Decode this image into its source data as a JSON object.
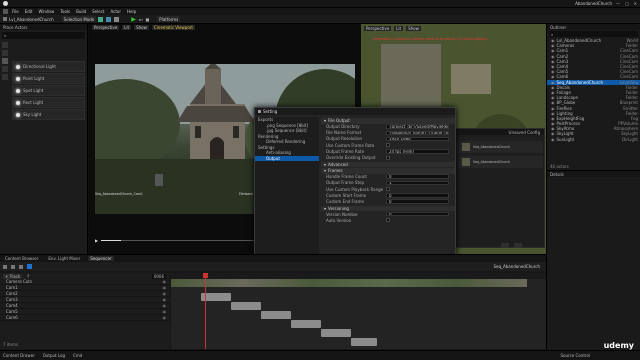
{
  "window": {
    "title": "AbandonedChurch"
  },
  "menu": [
    "File",
    "Edit",
    "Window",
    "Tools",
    "Build",
    "Select",
    "Actor",
    "Help"
  ],
  "toolbar": {
    "mode": "Selection Mode",
    "platforms": "Platforms"
  },
  "level_tab": "Lvl_AbandonedChurch",
  "place_actors": {
    "title": "Place Actors",
    "items": [
      "Directional Light",
      "Point Light",
      "Spot Light",
      "Rect Light",
      "Sky Light"
    ]
  },
  "viewport1": {
    "buttons": [
      "Perspective",
      "Lit",
      "Show",
      "Cinematic Viewport"
    ],
    "shot_label": "Seq_AbandonedChurch_Cam1",
    "info": "Filmback Preset: 16:9 DSLR | Zoom: 35 mm | Av: 2.8"
  },
  "viewport2": {
    "buttons": [
      "Perspective",
      "Lit",
      "Show"
    ],
    "warning": "Previewing in viewport. Lighting needs to be rebuilt (10 unbuilt objects)"
  },
  "dialog": {
    "title": "Setting",
    "nav": [
      {
        "label": "Exports",
        "indent": 0
      },
      {
        "label": ".png Sequence [8bit]",
        "indent": 1
      },
      {
        "label": ".jpg Sequence [8bit]",
        "indent": 1
      },
      {
        "label": "Rendering",
        "indent": 0
      },
      {
        "label": "Deferred Rendering",
        "indent": 1
      },
      {
        "label": "Settings",
        "indent": 0
      },
      {
        "label": "Anti-aliasing",
        "indent": 1
      },
      {
        "label": "Output",
        "indent": 1,
        "selected": true
      }
    ],
    "sections": [
      {
        "title": "File Output",
        "props": [
          {
            "label": "Output Directory",
            "value": "{project_dir}/Saved/MovieRenders/"
          },
          {
            "label": "File Name Format",
            "value": "{sequence_name}.{frame_number}"
          },
          {
            "label": "Output Resolution",
            "value": "1920     1080"
          },
          {
            "label": "Use Custom Frame Rate",
            "value": ""
          },
          {
            "label": "Output Frame Rate",
            "value": "24 fps (Film)"
          },
          {
            "label": "Override Existing Output",
            "value": ""
          }
        ]
      },
      {
        "title": "Advanced",
        "props": []
      },
      {
        "title": "Frames",
        "props": [
          {
            "label": "Handle Frame Count",
            "value": "0"
          },
          {
            "label": "Output Frame Step",
            "value": "1"
          },
          {
            "label": "Use Custom Playback Range",
            "value": ""
          },
          {
            "label": "Custom Start Frame",
            "value": "0"
          },
          {
            "label": "Custom End Frame",
            "value": "0"
          }
        ]
      },
      {
        "title": "Versioning",
        "props": [
          {
            "label": "Version Number",
            "value": "0"
          },
          {
            "label": "Auto Version",
            "value": ""
          }
        ]
      }
    ],
    "description": "A list of {format_strings} and example values that are valid to use in the File Name Format: {level_name} => L_AbandonedChurch {sequence_name} => Seq_AbandonedChurch {job_name} => Seq_AbandonedChurch {frame_rate} => 24",
    "cancel": "Cancel",
    "accept": "Accept"
  },
  "render_queue": {
    "title": "Unsaved Config",
    "jobs": [
      "Seq_AbandonedChurch",
      "Seq_AbandonedChurch"
    ]
  },
  "outliner": {
    "title": "Outliner",
    "items": [
      {
        "label": "Lvl_AbandonedChurch",
        "type": "World"
      },
      {
        "label": "Cameras",
        "type": "Folder"
      },
      {
        "label": "Cam1",
        "type": "CineCam"
      },
      {
        "label": "Cam2",
        "type": "CineCam"
      },
      {
        "label": "Cam3",
        "type": "CineCam"
      },
      {
        "label": "Cam4",
        "type": "CineCam"
      },
      {
        "label": "Cam5",
        "type": "CineCam"
      },
      {
        "label": "Cam6",
        "type": "CineCam"
      },
      {
        "label": "Seq_AbandonedChurch",
        "type": "LevelSeq"
      },
      {
        "label": "Decals",
        "type": "Folder"
      },
      {
        "label": "Foliage",
        "type": "Folder"
      },
      {
        "label": "Landscape",
        "type": "Folder"
      },
      {
        "label": "BP_Globe",
        "type": "Blueprint"
      },
      {
        "label": "Fireflies",
        "type": "Emitter"
      },
      {
        "label": "Lighting",
        "type": "Folder"
      },
      {
        "label": "ExpHeightFog",
        "type": "Fog"
      },
      {
        "label": "PostProcess",
        "type": "PPVolume"
      },
      {
        "label": "SkyAtmo",
        "type": "Atmosphere"
      },
      {
        "label": "SkyLight",
        "type": "SkyLight"
      },
      {
        "label": "SunLight",
        "type": "DirLight"
      }
    ],
    "count": "40 actors"
  },
  "details": {
    "title": "Details"
  },
  "sequencer": {
    "tabs": [
      "Content Browser",
      "Env. Light Mixer",
      "Sequencer"
    ],
    "seq_name": "Seq_AbandonedChurch",
    "track_button": "+ Track",
    "tracks": [
      "Camera Cuts",
      "Cam1",
      "Cam2",
      "Cam3",
      "Cam4",
      "Cam5",
      "Cam6"
    ],
    "current_frame": "0006",
    "items_count": "7 items",
    "shots": [
      0,
      1,
      2,
      3,
      4,
      5
    ]
  },
  "status": {
    "left": [
      "Content Drawer",
      "Output Log",
      "Cmd"
    ],
    "right": "Source Control"
  },
  "brand": "udemy"
}
